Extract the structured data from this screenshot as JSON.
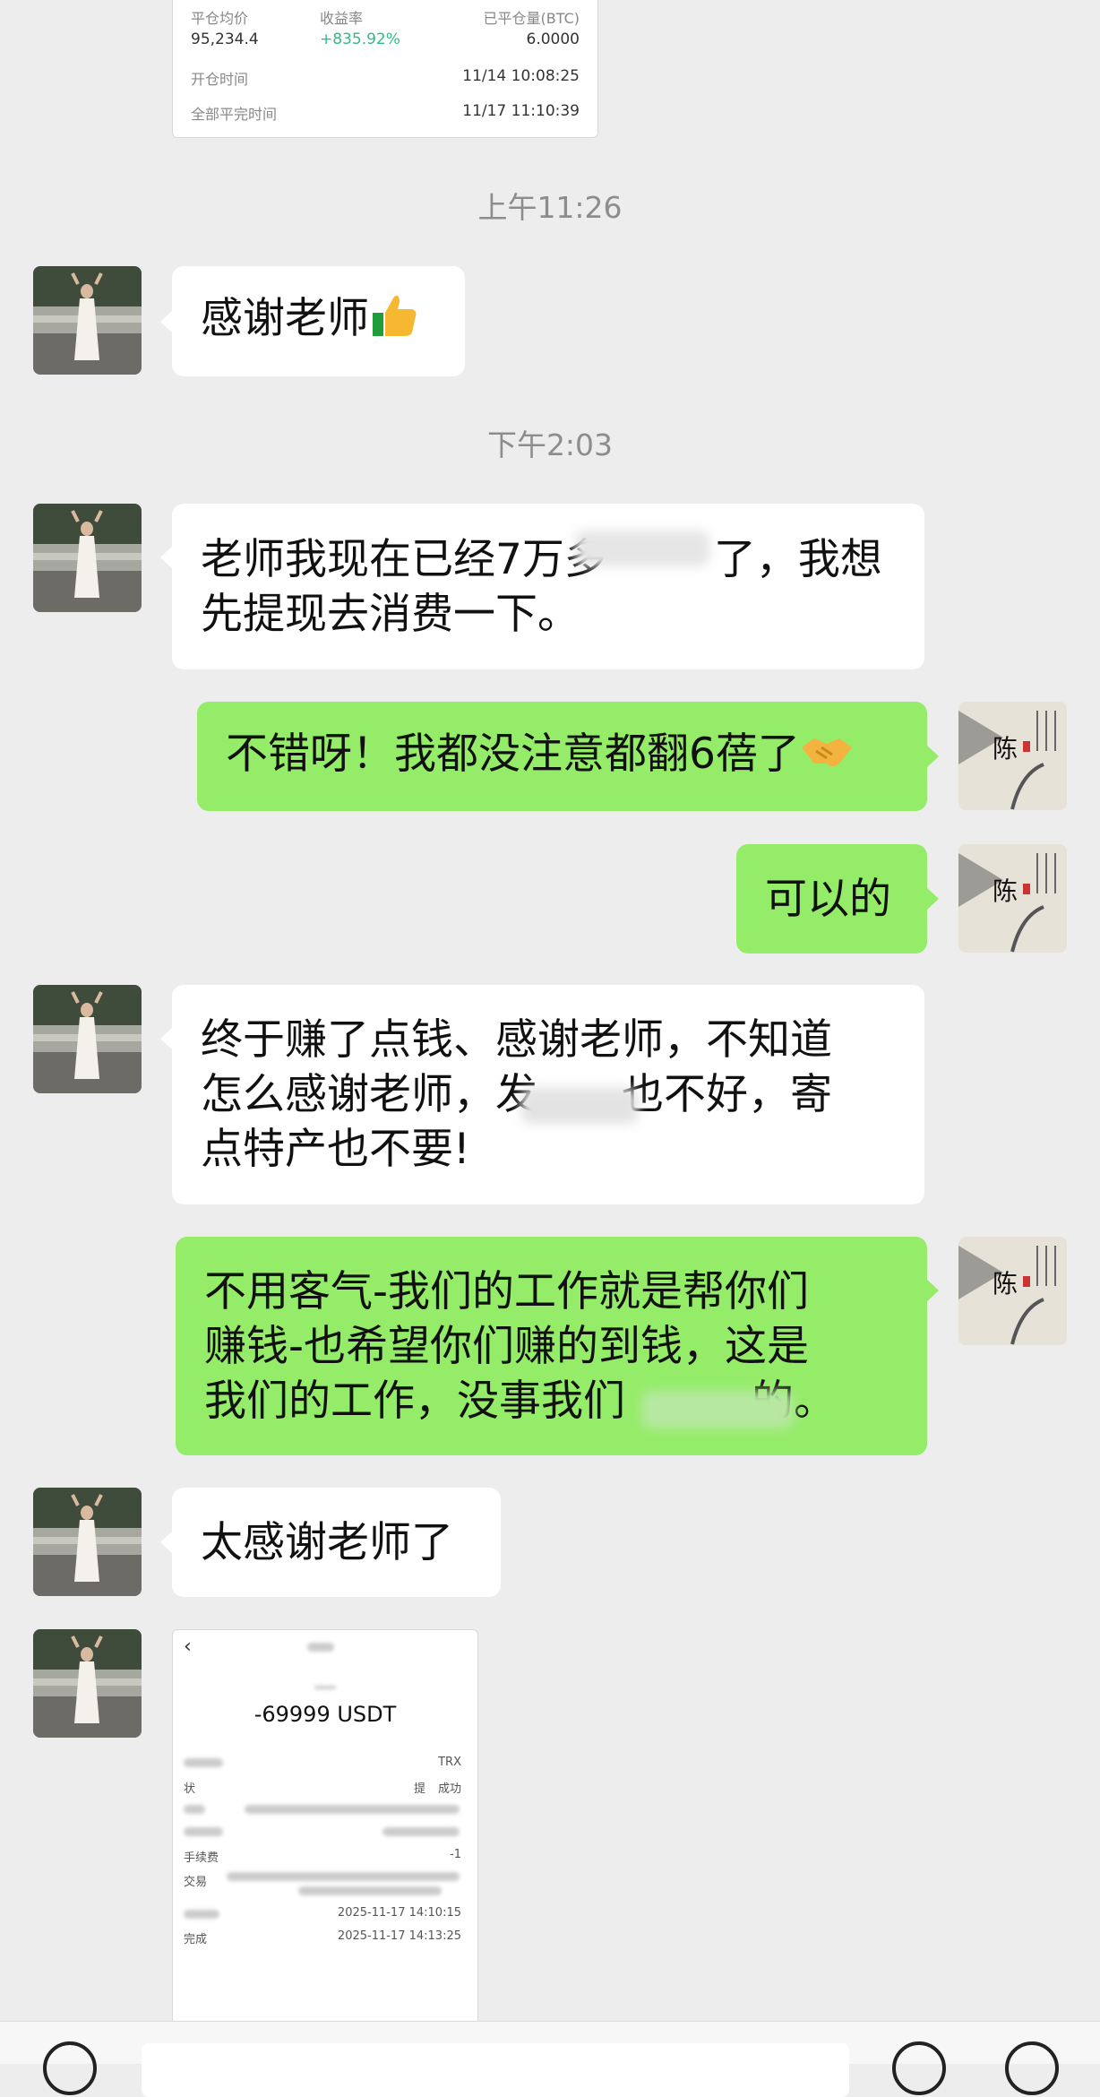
{
  "trade_card": {
    "col1_label": "平仓均价",
    "col1_value": "95,234.4",
    "col2_label": "收益率",
    "col2_value": "+835.92%",
    "col3_label": "已平仓量(BTC)",
    "col3_value": "6.0000",
    "open_time_label": "开仓时间",
    "open_time_value": "11/14 10:08:25",
    "close_time_label": "全部平完时间",
    "close_time_value": "11/17 11:10:39",
    "profit_color": "#2ebd85"
  },
  "messages": {
    "time_1": "上午11:26",
    "msg_1": "感谢老师",
    "time_2": "下午2:03",
    "msg_2_line1": "老师我现在已经7万多",
    "msg_2_line1_end": "了，我想",
    "msg_2_line2": "先提现去消费一下。",
    "msg_3": "不错呀！我都没注意都翻6蓓了",
    "msg_4": "可以的",
    "msg_5_line1": "终于赚了点钱、感谢老师，不知道",
    "msg_5_line2a": "怎么感谢老师，发",
    "msg_5_line2b": "也不好，寄",
    "msg_5_line3": "点特产也不要!",
    "msg_6_line1": "不用客气-我们的工作就是帮你们",
    "msg_6_line2": "赚钱-也希望你们赚的到钱，这是",
    "msg_6_line3a": "我们的工作，没事我们",
    "msg_6_line3b": "的。",
    "msg_7": "太感谢老师了"
  },
  "receipt": {
    "amount": "-69999 USDT",
    "row1_value": "TRX",
    "row2_label": "状",
    "row2_value": "提",
    "row2_value_end": "成功",
    "row5_label": "手续费",
    "row5_value": "-1",
    "row6_label": "交易",
    "row7_value": "2025-11-17 14:10:15",
    "row8_label": "完成",
    "row8_value": "2025-11-17 14:13:25"
  },
  "icons": {
    "thumbs_up": "thumbs-up-emoji",
    "handshake": "handshake-emoji",
    "back": "chevron-left-icon"
  },
  "colors": {
    "background": "#ededed",
    "incoming_bubble": "#ffffff",
    "outgoing_bubble": "#95ec69",
    "timestamp": "#8d8d8d"
  }
}
